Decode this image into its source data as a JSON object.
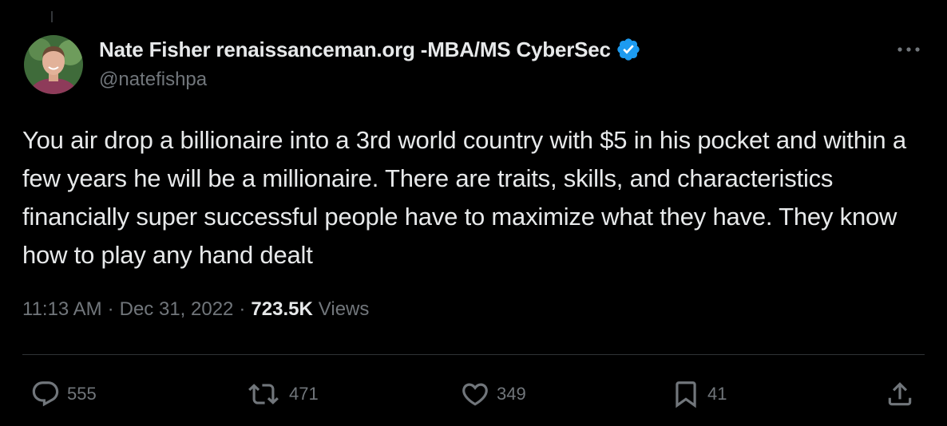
{
  "author": {
    "display_name": "Nate Fisher renaissanceman.org -MBA/MS CyberSec",
    "handle": "@natefishpa",
    "verified_icon": "verified-badge-icon"
  },
  "tweet": {
    "text": "You air drop a billionaire into a 3rd world country with $5 in his pocket and within a few years he will be a millionaire. There are traits, skills, and characteristics financially super successful people have to maximize what they have. They know how to play any hand dealt",
    "time": "11:13 AM",
    "date": "Dec 31, 2022",
    "separator": "·",
    "views_count": "723.5K",
    "views_label": "Views"
  },
  "actions": {
    "replies": "555",
    "retweets": "471",
    "likes": "349",
    "bookmarks": "41"
  },
  "colors": {
    "background": "#000000",
    "text": "#e7e9ea",
    "secondary": "#71767b",
    "verified": "#1d9bf0",
    "divider": "#2f3336"
  },
  "icons": [
    "more-icon",
    "reply-icon",
    "retweet-icon",
    "like-icon",
    "bookmark-icon",
    "share-icon"
  ]
}
